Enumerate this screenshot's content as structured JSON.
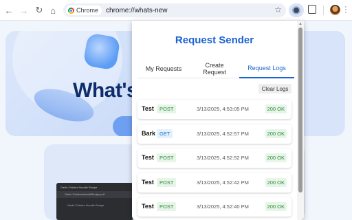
{
  "browser": {
    "chip_label": "Chrome",
    "url": "chrome://whats-new"
  },
  "page": {
    "hero_heading": "What's"
  },
  "preview_doc": {
    "tab_title": "Garlic Chicken Noodle Recipe",
    "address": "Garlic ChickenNoodleRecipe.pdf",
    "line": "Garlic Chicken Noodle Recipe"
  },
  "popup": {
    "title": "Request Sender",
    "tabs": [
      "My Requests",
      "Create Request",
      "Request Logs"
    ],
    "active_tab": "Request Logs",
    "clear_label": "Clear Logs",
    "logs": [
      {
        "name": "Test",
        "method": "POST",
        "time": "3/13/2025, 4:53:05 PM",
        "status": "200 OK"
      },
      {
        "name": "Bark",
        "method": "GET",
        "time": "3/13/2025, 4:52:57 PM",
        "status": "200 OK"
      },
      {
        "name": "Test",
        "method": "POST",
        "time": "3/13/2025, 4:52:52 PM",
        "status": "200 OK"
      },
      {
        "name": "Test",
        "method": "POST",
        "time": "3/13/2025, 4:52:42 PM",
        "status": "200 OK"
      },
      {
        "name": "Test",
        "method": "POST",
        "time": "3/13/2025, 4:52:40 PM",
        "status": "200 OK"
      }
    ]
  },
  "colors": {
    "accent": "#1a63d1",
    "post": "#2e8b3a",
    "get": "#2270c4"
  }
}
